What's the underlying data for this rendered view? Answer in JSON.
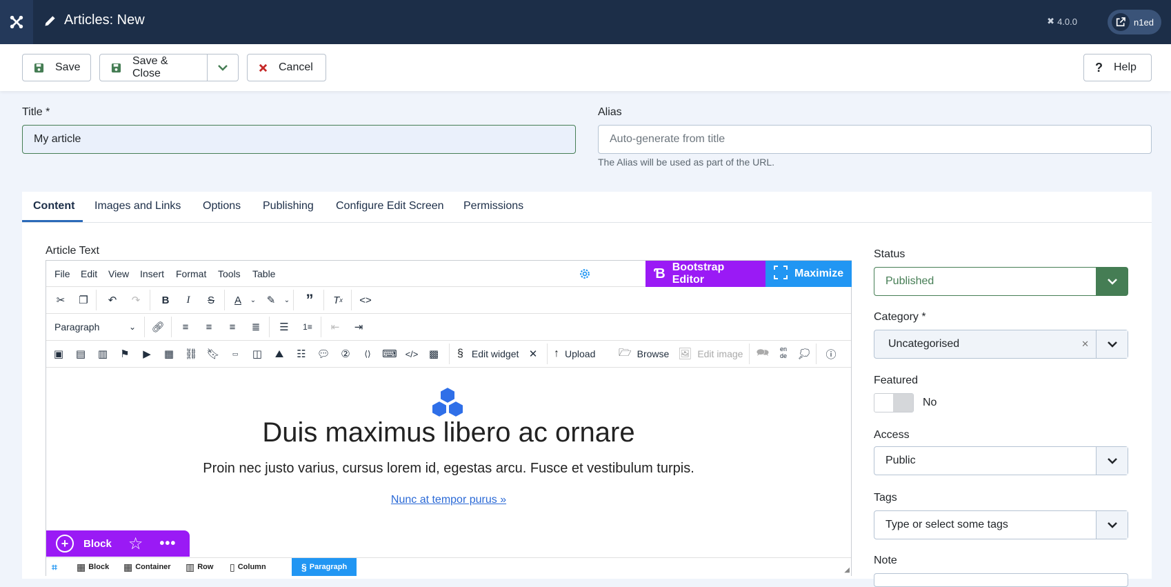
{
  "header": {
    "title": "Articles: New",
    "version": "4.0.0",
    "user": "n1ed"
  },
  "toolbar": {
    "save": "Save",
    "save_close": "Save & Close",
    "cancel": "Cancel",
    "help": "Help"
  },
  "form": {
    "title_label": "Title *",
    "title_value": "My article",
    "alias_label": "Alias",
    "alias_placeholder": "Auto-generate from title",
    "alias_hint": "The Alias will be used as part of the URL."
  },
  "tabs": [
    "Content",
    "Images and Links",
    "Options",
    "Publishing",
    "Configure Edit Screen",
    "Permissions"
  ],
  "editor": {
    "label": "Article Text",
    "menus": [
      "File",
      "Edit",
      "View",
      "Insert",
      "Format",
      "Tools",
      "Table"
    ],
    "bootstrap_editor": "Bootstrap Editor",
    "maximize": "Maximize",
    "format_select": "Paragraph",
    "edit_widget": "Edit widget",
    "upload": "Upload",
    "browse": "Browse",
    "edit_image": "Edit image",
    "lang_top": "en",
    "lang_bottom": "de",
    "heading": "Duis maximus libero ac ornare",
    "paragraph": "Proin nec justo varius, cursus lorem id, egestas arcu. Fusce et vestibulum turpis.",
    "link": "Nunc at tempor purus »",
    "block_label": "Block",
    "breadcrumb": [
      "Block",
      "Container",
      "Row",
      "Column",
      "Paragraph"
    ]
  },
  "sidebar": {
    "status_label": "Status",
    "status_value": "Published",
    "category_label": "Category *",
    "category_value": "Uncategorised",
    "featured_label": "Featured",
    "featured_value": "No",
    "access_label": "Access",
    "access_value": "Public",
    "tags_label": "Tags",
    "tags_placeholder": "Type or select some tags",
    "note_label": "Note"
  },
  "colors": {
    "header_bg": "#1c2e48",
    "accent_purple": "#9a1af5",
    "accent_blue": "#2196f3",
    "published_green": "#457d54",
    "cancel_red": "#c52827"
  }
}
